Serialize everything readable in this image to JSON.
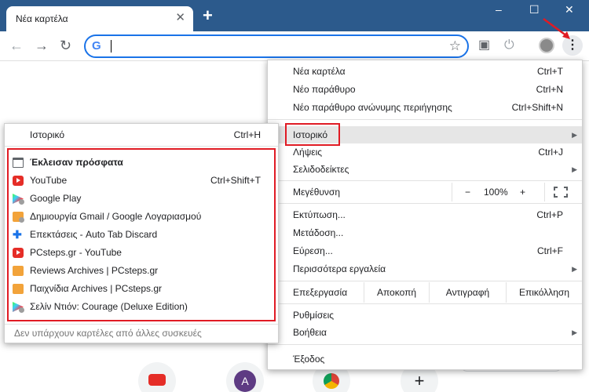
{
  "tab": {
    "title": "Νέα καρτέλα",
    "close": "✕",
    "new_tab": "+"
  },
  "window": {
    "minimize": "–",
    "maximize": "☐",
    "close": "✕"
  },
  "toolbar": {
    "back": "←",
    "forward": "→",
    "reload": "↻",
    "star": "☆",
    "omnibox_value": "",
    "omnibox_logo": "G",
    "menu": "⋮",
    "cast": "▣",
    "power": "⏻"
  },
  "main_menu": {
    "new_tab": {
      "label": "Νέα καρτέλα",
      "shortcut": "Ctrl+T"
    },
    "new_window": {
      "label": "Νέο παράθυρο",
      "shortcut": "Ctrl+N"
    },
    "incognito": {
      "label": "Νέο παράθυρο ανώνυμης περιήγησης",
      "shortcut": "Ctrl+Shift+N"
    },
    "history": {
      "label": "Ιστορικό",
      "arrow": "▶"
    },
    "downloads": {
      "label": "Λήψεις",
      "shortcut": "Ctrl+J"
    },
    "bookmarks": {
      "label": "Σελιδοδείκτες",
      "arrow": "▶"
    },
    "zoom": {
      "label": "Μεγέθυνση",
      "minus": "−",
      "value": "100%",
      "plus": "+"
    },
    "print": {
      "label": "Εκτύπωση...",
      "shortcut": "Ctrl+P"
    },
    "cast": {
      "label": "Μετάδοση..."
    },
    "find": {
      "label": "Εύρεση...",
      "shortcut": "Ctrl+F"
    },
    "more_tools": {
      "label": "Περισσότερα εργαλεία",
      "arrow": "▶"
    },
    "edit": {
      "label": "Επεξεργασία",
      "cut": "Αποκοπή",
      "copy": "Αντιγραφή",
      "paste": "Επικόλληση"
    },
    "settings": {
      "label": "Ρυθμίσεις"
    },
    "help": {
      "label": "Βοήθεια",
      "arrow": "▶"
    },
    "exit": {
      "label": "Έξοδος"
    }
  },
  "history_submenu": {
    "history": {
      "label": "Ιστορικό",
      "shortcut": "Ctrl+H"
    },
    "recently_closed": "Έκλεισαν πρόσφατα",
    "items": [
      {
        "label": "YouTube",
        "shortcut": "Ctrl+Shift+T",
        "icon": "youtube-icon"
      },
      {
        "label": "Google Play",
        "shortcut": "",
        "icon": "google-play-icon"
      },
      {
        "label": "Δημιουργία Gmail / Google Λογαριασμού",
        "shortcut": "",
        "icon": "pcsteps-icon"
      },
      {
        "label": "Επεκτάσεις - Auto Tab Discard",
        "shortcut": "",
        "icon": "puzzle-icon"
      },
      {
        "label": "PCsteps.gr - YouTube",
        "shortcut": "",
        "icon": "youtube-icon"
      },
      {
        "label": "Reviews Archives | PCsteps.gr",
        "shortcut": "",
        "icon": "pcsteps-icon"
      },
      {
        "label": "Παιχνίδια Archives | PCsteps.gr",
        "shortcut": "",
        "icon": "pcsteps-icon"
      },
      {
        "label": "Σελίν Ντιόν: Courage (Deluxe Edition)",
        "shortcut": "",
        "icon": "google-play-icon"
      }
    ],
    "footer": "Δεν υπάρχουν καρτέλες από άλλες συσκευές"
  },
  "shortcuts": {
    "a_letter": "A",
    "plus": "+"
  },
  "colors": {
    "titlebar": "#2c5a8c",
    "highlight_box": "#e01b24",
    "accent": "#1a73e8"
  }
}
